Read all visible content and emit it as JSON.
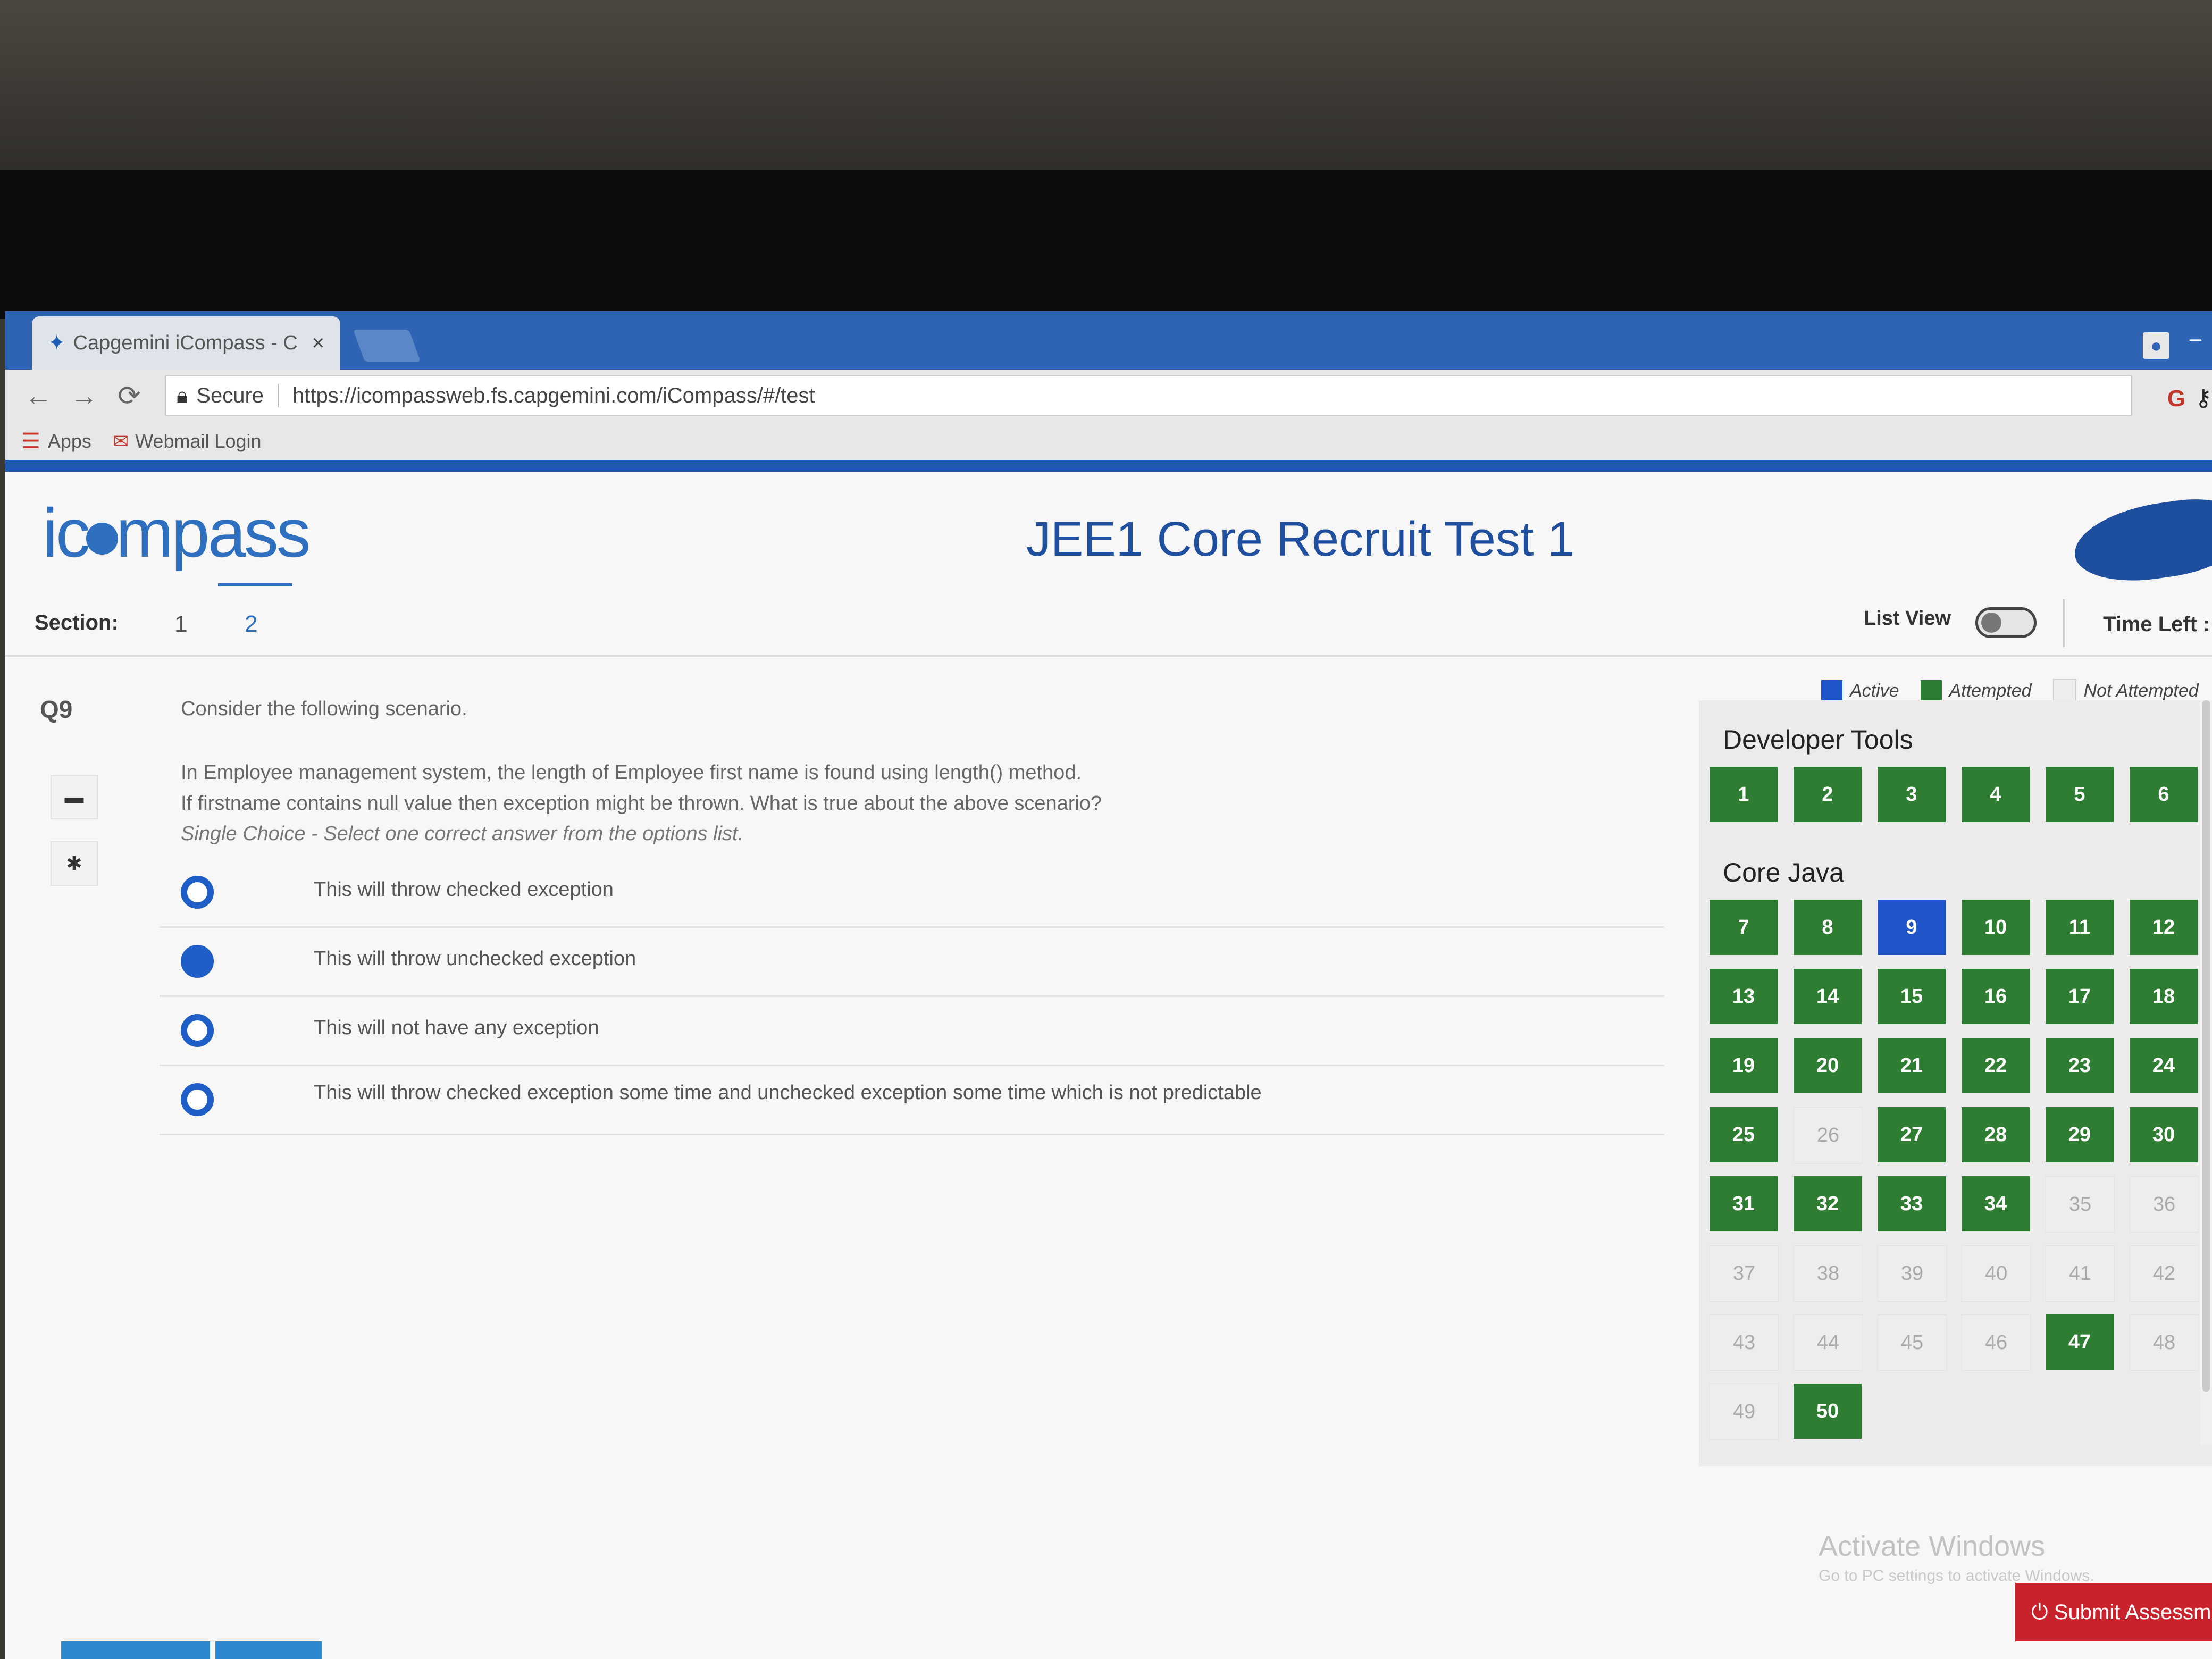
{
  "browser": {
    "tab_title": "Capgemini iCompass - C",
    "tab_close": "×",
    "address_secure": "Secure",
    "url": "https://icompassweb.fs.capgemini.com/iCompass/#/test",
    "bookmarks": [
      "Apps",
      "Webmail Login"
    ]
  },
  "header": {
    "logo_left": "ic",
    "logo_right": "mpass",
    "test_title": "JEE1 Core Recruit Test 1"
  },
  "section": {
    "label": "Section:",
    "tabs": [
      "1",
      "2"
    ],
    "active_tab": "2",
    "list_view_label": "List View",
    "time_left_label": "Time Left :"
  },
  "question": {
    "number": "Q9",
    "intro": "Consider the following scenario.",
    "body_line1": "In Employee management system, the length of Employee first name is found using length() method.",
    "body_line2": "If firstname contains null value then exception might be thrown. What is true about the above scenario?",
    "instruction": "Single Choice - Select one correct answer from the options list.",
    "options": [
      "This will throw checked exception",
      "This will throw unchecked exception",
      "This will not have any exception",
      "This will throw checked exception some time and unchecked exception some time which is not predictable"
    ],
    "selected_index": 1
  },
  "legend": {
    "active": "Active",
    "attempted": "Attempted",
    "not_attempted": "Not Attempted",
    "colors": {
      "active": "#1f55c8",
      "attempted": "#2f7d32",
      "not_attempted": "#ededed"
    }
  },
  "palette": {
    "group1_title": "Developer Tools",
    "group2_title": "Core Java",
    "active_question": 9,
    "attempted": [
      1,
      2,
      3,
      4,
      5,
      6,
      7,
      8,
      10,
      11,
      12,
      13,
      14,
      15,
      16,
      17,
      18,
      19,
      20,
      21,
      22,
      23,
      24,
      25,
      27,
      28,
      29,
      30,
      31,
      32,
      33,
      34,
      47,
      50
    ],
    "not_attempted": [
      26,
      35,
      36,
      37,
      38,
      39,
      40,
      41,
      42,
      43,
      44,
      45,
      46,
      48,
      49
    ]
  },
  "footer": {
    "activate_title": "Activate Windows",
    "activate_sub": "Go to PC settings to activate Windows.",
    "submit_label": "Submit Assessment"
  }
}
